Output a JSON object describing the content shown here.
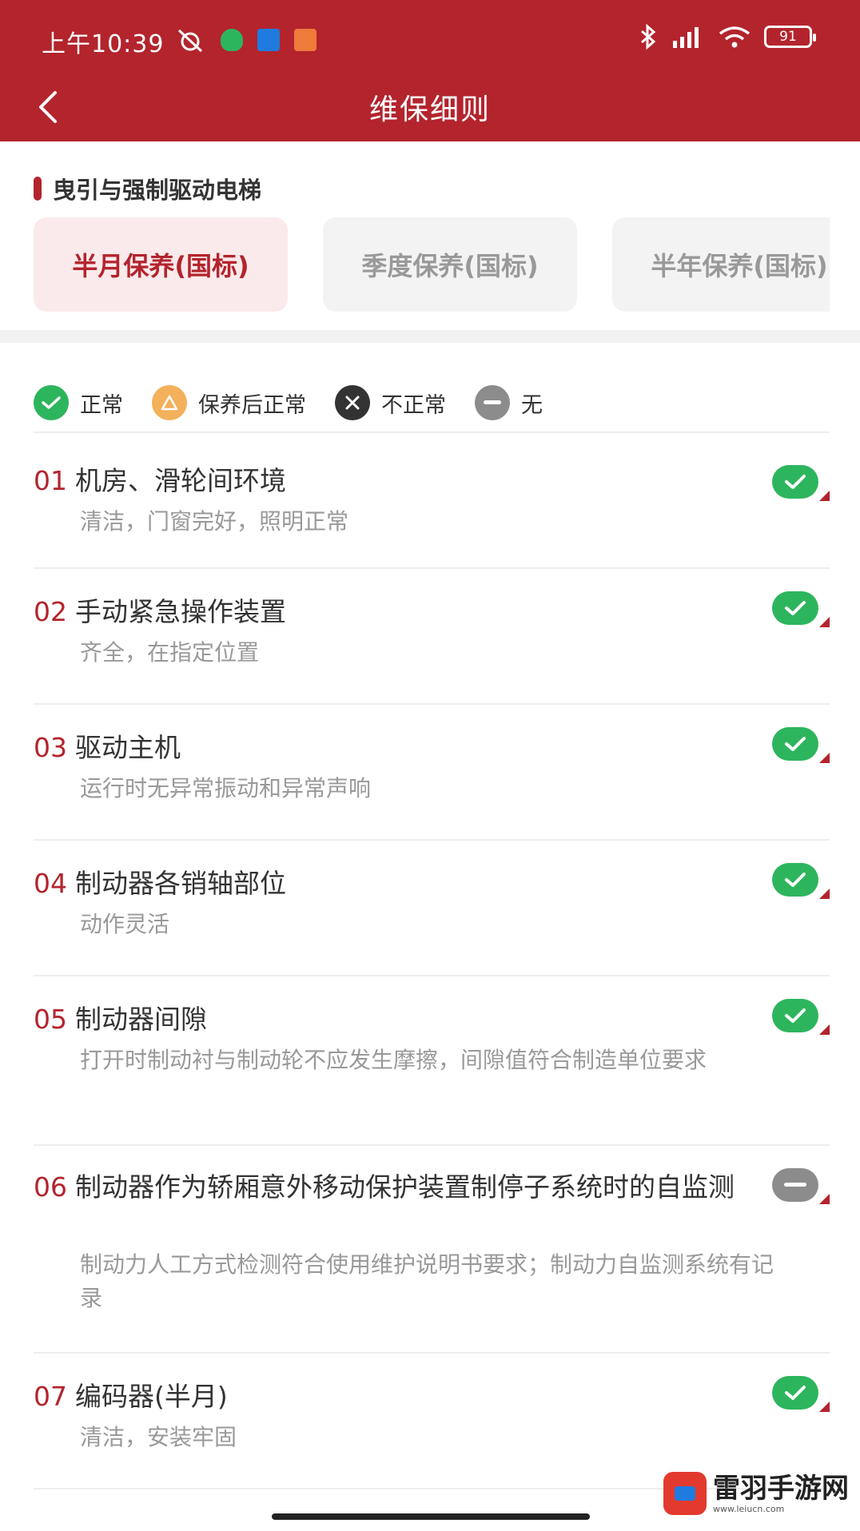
{
  "status_bar": {
    "time": "上午10:39",
    "battery": "91"
  },
  "nav": {
    "title": "维保细则"
  },
  "category": {
    "title": "曳引与强制驱动电梯"
  },
  "tabs": [
    {
      "label": "半月保养(国标)",
      "active": true
    },
    {
      "label": "季度保养(国标)",
      "active": false
    },
    {
      "label": "半年保养(国标)",
      "active": false
    }
  ],
  "legend": [
    {
      "label": "正常",
      "icon": "check-icon",
      "color": "#2db55d"
    },
    {
      "label": "保养后正常",
      "icon": "triangle-icon",
      "color": "#f4b05a"
    },
    {
      "label": "不正常",
      "icon": "cross-icon",
      "color": "#333333"
    },
    {
      "label": "无",
      "icon": "minus-icon",
      "color": "#8c8c8c"
    }
  ],
  "items": [
    {
      "num": "01",
      "title": "机房、滑轮间环境",
      "desc": "清洁，门窗完好，照明正常",
      "status": "normal"
    },
    {
      "num": "02",
      "title": "手动紧急操作装置",
      "desc": "齐全，在指定位置",
      "status": "normal"
    },
    {
      "num": "03",
      "title": "驱动主机",
      "desc": "运行时无异常振动和异常声响",
      "status": "normal"
    },
    {
      "num": "04",
      "title": "制动器各销轴部位",
      "desc": "动作灵活",
      "status": "normal"
    },
    {
      "num": "05",
      "title": "制动器间隙",
      "desc": "打开时制动衬与制动轮不应发生摩擦，间隙值符合制造单位要求",
      "status": "normal"
    },
    {
      "num": "06",
      "title": "制动器作为轿厢意外移动保护装置制停子系统时的自监测",
      "desc": "制动力人工方式检测符合使用维护说明书要求；制动力自监测系统有记录",
      "status": "none"
    },
    {
      "num": "07",
      "title": "编码器(半月)",
      "desc": "清洁，安装牢固",
      "status": "normal"
    }
  ],
  "watermark": {
    "main": "雷羽手游网",
    "sub": "www.leiucn.com"
  },
  "colors": {
    "brand": "#b3242d",
    "normal": "#2db55d",
    "none": "#8c8c8c"
  }
}
